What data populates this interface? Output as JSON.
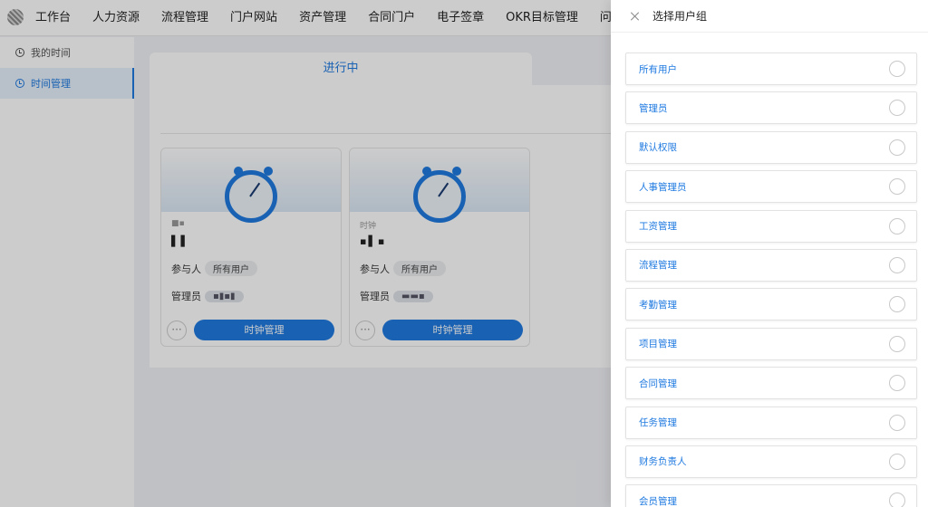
{
  "nav": [
    "工作台",
    "人力资源",
    "流程管理",
    "门户网站",
    "资产管理",
    "合同门户",
    "电子签章",
    "OKR目标管理",
    "问卷调"
  ],
  "sidebar": {
    "items": [
      {
        "label": "我的时间",
        "active": false
      },
      {
        "label": "时间管理",
        "active": true
      }
    ]
  },
  "main": {
    "tab_label": "进行中",
    "cards": [
      {
        "meta": "■▪",
        "title": "▌▌",
        "participants_label": "参与人",
        "participants_value": "所有用户",
        "admin_label": "管理员",
        "admin_value": "▪▮▪▮",
        "more_label": "···",
        "button_label": "时钟管理"
      },
      {
        "meta": "时钟",
        "title": "▪▌▪",
        "participants_label": "参与人",
        "participants_value": "所有用户",
        "admin_label": "管理员",
        "admin_value": "▬▬▪",
        "more_label": "···",
        "button_label": "时钟管理"
      }
    ]
  },
  "drawer": {
    "title": "选择用户组",
    "groups": [
      "所有用户",
      "管理员",
      "默认权限",
      "人事管理员",
      "工资管理",
      "流程管理",
      "考勤管理",
      "项目管理",
      "合同管理",
      "任务管理",
      "财务负责人",
      "会员管理"
    ]
  },
  "colors": {
    "accent": "#1f7ae0",
    "mask": "rgba(0,0,0,0.2)"
  }
}
